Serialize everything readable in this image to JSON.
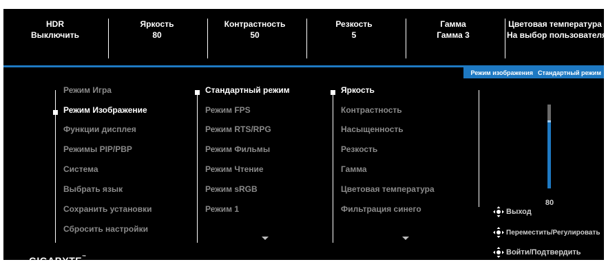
{
  "status": [
    {
      "name": "HDR",
      "value": "Выключить"
    },
    {
      "name": "Яркость",
      "value": "80"
    },
    {
      "name": "Контрастность",
      "value": "50"
    },
    {
      "name": "Резкость",
      "value": "5"
    },
    {
      "name": "Гамма",
      "value": "Гамма 3"
    },
    {
      "name": "Цветовая температура",
      "value": "На выбор пользователя"
    }
  ],
  "breadcrumb": {
    "section": "Режим изображения",
    "current": "Стандартный режим"
  },
  "main_menu": [
    {
      "label": "Режим Игра",
      "selected": false
    },
    {
      "label": "Режим Изображение",
      "selected": true
    },
    {
      "label": "Функции дисплея",
      "selected": false
    },
    {
      "label": "Режимы PIP/PBP",
      "selected": false
    },
    {
      "label": "Система",
      "selected": false
    },
    {
      "label": "Выбрать язык",
      "selected": false
    },
    {
      "label": "Сохранить установки",
      "selected": false
    },
    {
      "label": "Сбросить настройки",
      "selected": false
    }
  ],
  "picture_modes": [
    {
      "label": "Стандартный режим",
      "selected": true
    },
    {
      "label": "Режим FPS",
      "selected": false
    },
    {
      "label": "Режим RTS/RPG",
      "selected": false
    },
    {
      "label": "Режим Фильмы",
      "selected": false
    },
    {
      "label": "Режим Чтение",
      "selected": false
    },
    {
      "label": "Режим sRGB",
      "selected": false
    },
    {
      "label": "Режим 1",
      "selected": false
    }
  ],
  "settings": [
    {
      "label": "Яркость",
      "selected": true
    },
    {
      "label": "Контрастность",
      "selected": false
    },
    {
      "label": "Насыщенность",
      "selected": false
    },
    {
      "label": "Резкость",
      "selected": false
    },
    {
      "label": "Гамма",
      "selected": false
    },
    {
      "label": "Цветовая температура",
      "selected": false
    },
    {
      "label": "Фильтрация синего",
      "selected": false
    }
  ],
  "slider": {
    "value": "80",
    "level": 0.8
  },
  "help": {
    "exit": "Выход",
    "move": "Переместить/Регулировать",
    "enter": "Войти/Подтвердить"
  },
  "brand": {
    "name": "GIGABYTE",
    "mark": "™"
  },
  "colors": {
    "accent": "#1e79c2",
    "background": "#000000",
    "dim_text": "#8a8a8a"
  }
}
